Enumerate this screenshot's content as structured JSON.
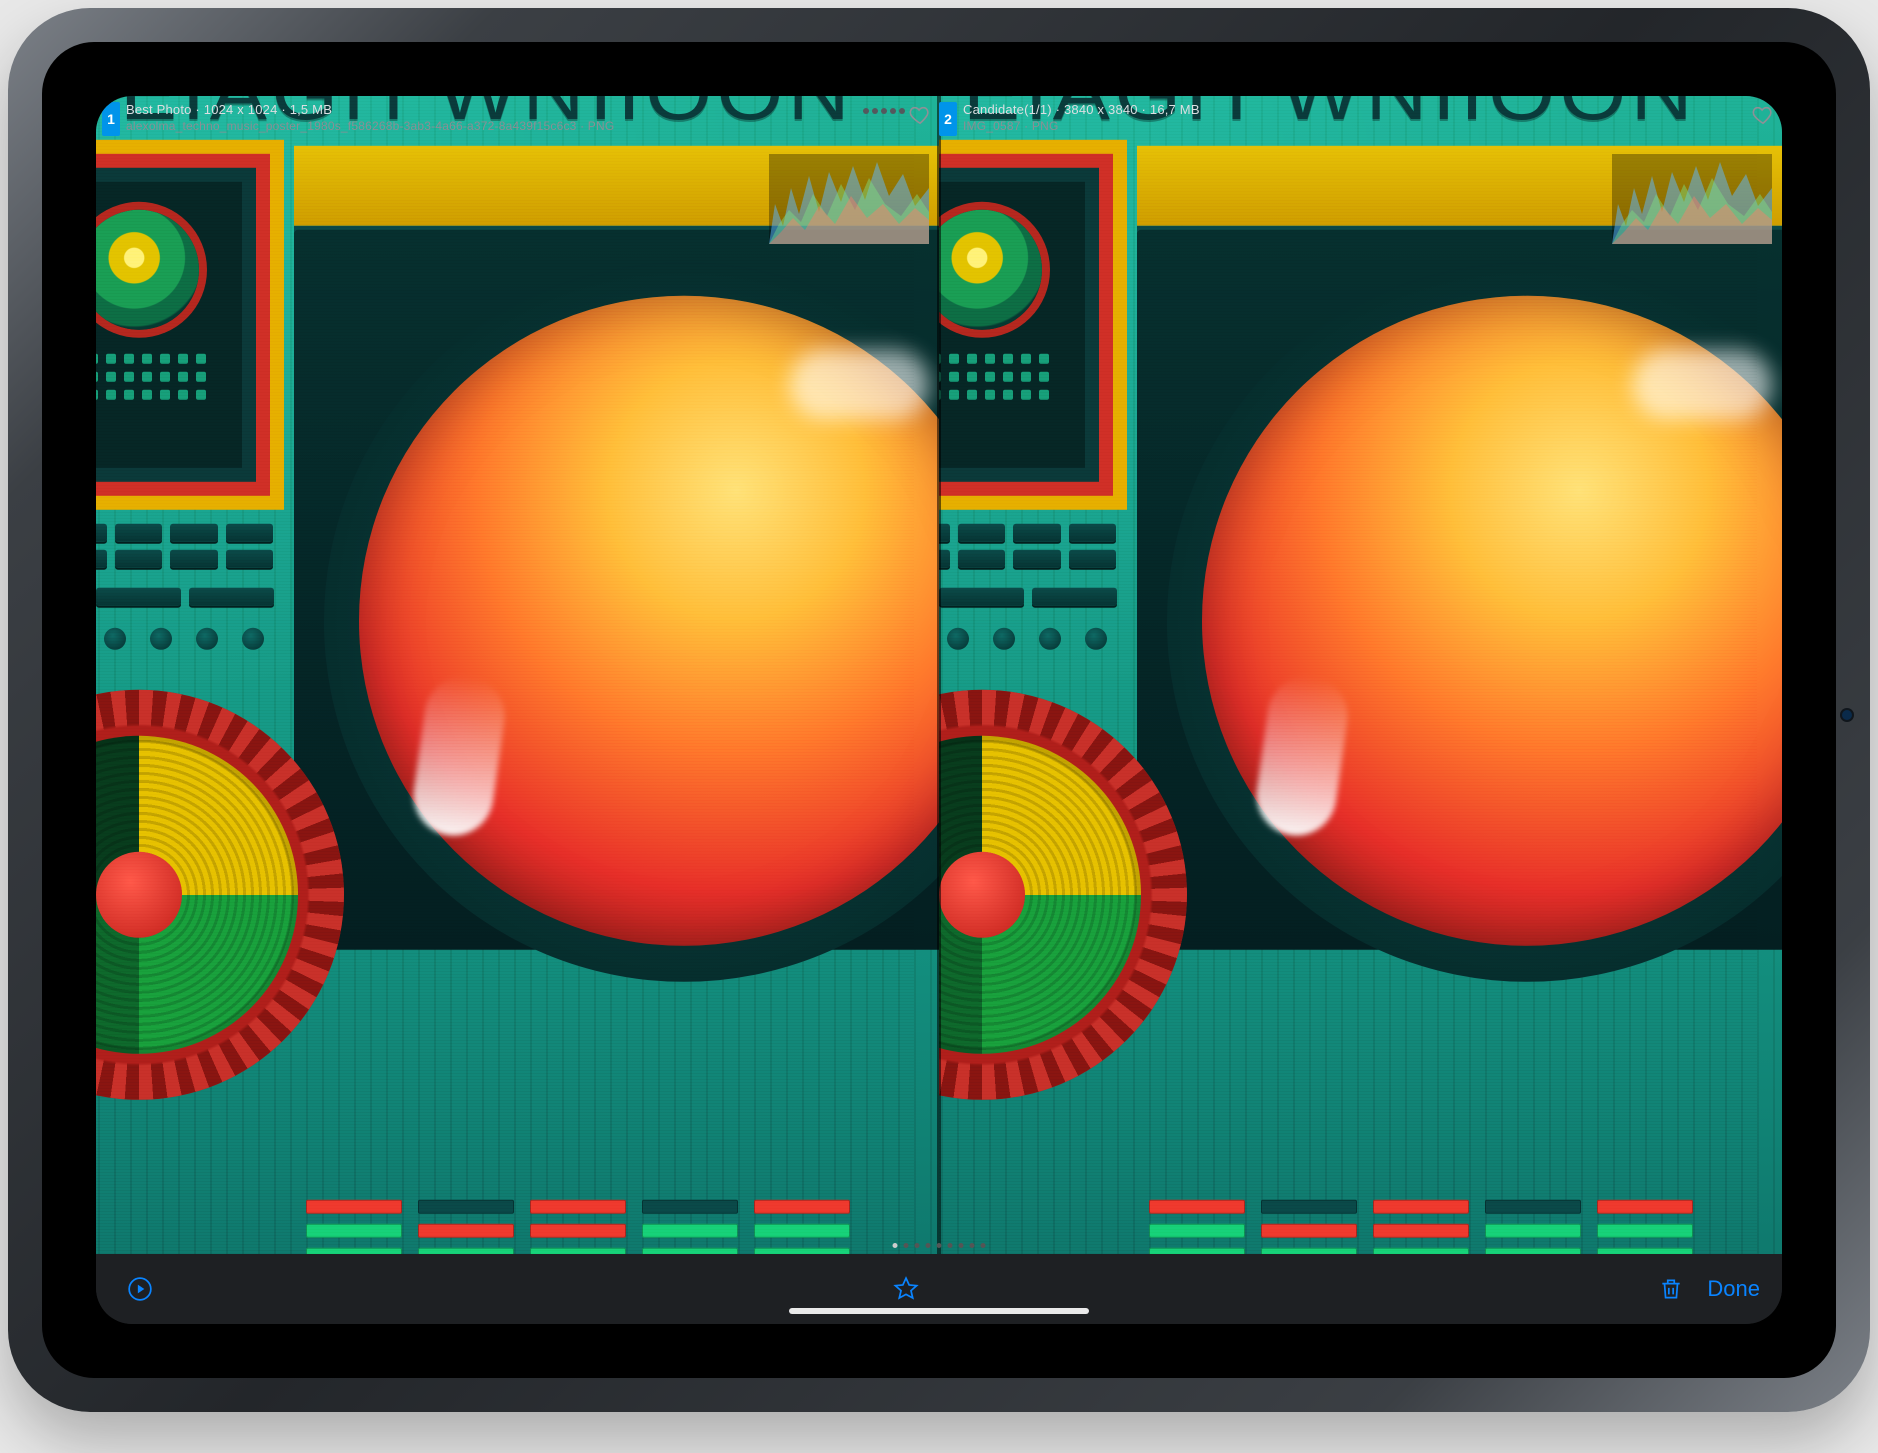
{
  "panes": [
    {
      "index": "1",
      "title": "Best Photo",
      "dimensions": "1024 x 1024",
      "filesize": "1,5 MB",
      "filename": "alexolma_techno_music_poster_1980s_f586268b-3ab3-4a66-a372-8a439f15c6c3",
      "ext": "PNG",
      "favorite": false
    },
    {
      "index": "2",
      "title": "Candidate(1/1)",
      "dimensions": "3840 x 3840",
      "filesize": "16,7 MB",
      "filename": "IMG_0587",
      "ext": "PNG",
      "favorite": false
    }
  ],
  "artwork": {
    "titleText": "TEIAGH WNIIOON"
  },
  "toolbar": {
    "done_label": "Done"
  },
  "icons": {
    "play": "play-circle",
    "star": "star",
    "trash": "trash",
    "heart": "heart"
  }
}
